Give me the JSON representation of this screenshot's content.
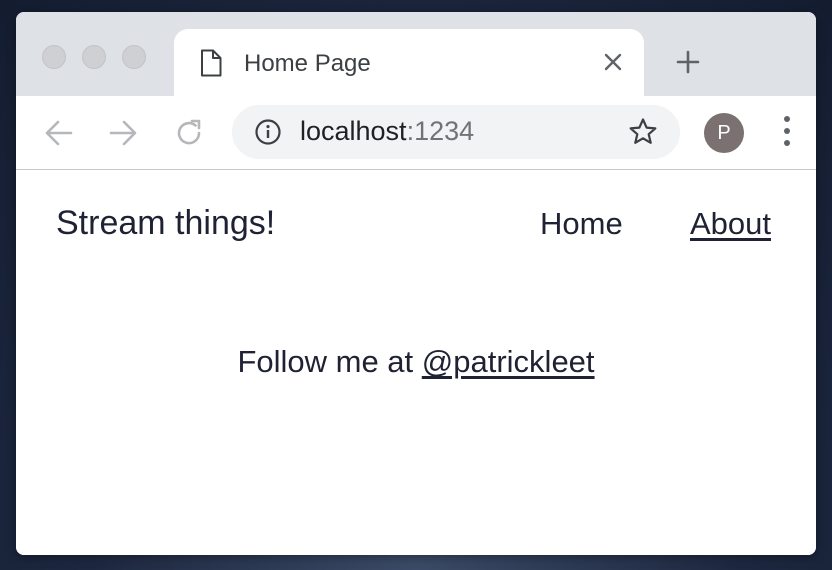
{
  "browser": {
    "tab": {
      "title": "Home Page",
      "icon": "page-icon"
    },
    "new_tab_icon": "plus-icon",
    "address_bar": {
      "host": "localhost",
      "port": ":1234"
    },
    "profile": {
      "initial": "P"
    },
    "colors": {
      "tabstrip": "#dee1e6",
      "omnibox": "#f1f3f4",
      "avatar": "#7a7170"
    }
  },
  "site": {
    "title": "Stream things!",
    "nav": [
      {
        "label": "Home"
      },
      {
        "label": "About"
      }
    ],
    "follow": {
      "prefix": "Follow me at ",
      "handle": "@patrickleet"
    },
    "colors": {
      "text": "#1f2233",
      "background": "#ffffff"
    }
  }
}
